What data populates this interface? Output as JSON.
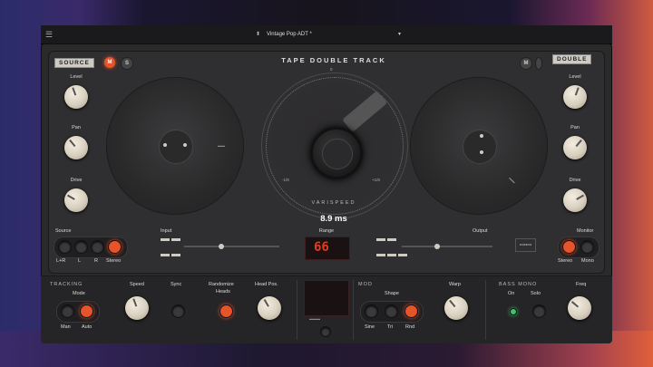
{
  "topbar": {
    "menu_icon": "menu-icon",
    "preset_name": "Vintage Pop ADT *",
    "preset_arrows": "⬍",
    "dropdown_icon": "▾"
  },
  "header": {
    "source_tag": "SOURCE",
    "double_tag": "DOUBLE",
    "title": "TAPE DOUBLE TRACK",
    "m_label": "M",
    "s_label": "S"
  },
  "left_knobs": [
    {
      "label": "Level"
    },
    {
      "label": "Pan"
    },
    {
      "label": "Drive"
    }
  ],
  "right_knobs": [
    {
      "label": "Level"
    },
    {
      "label": "Pan"
    },
    {
      "label": "Drive"
    }
  ],
  "varispeed": {
    "label": "VARISPEED",
    "value": "8.9 ms",
    "range_label": "Range",
    "scale_min": "-1/8",
    "scale_max": "+1/8",
    "scale_top": "0"
  },
  "source": {
    "label": "Source",
    "buttons": [
      "L+R",
      "L",
      "R",
      "Stereo"
    ]
  },
  "monitor": {
    "label": "Monitor",
    "buttons": [
      "Stereo",
      "Mono"
    ]
  },
  "input": {
    "label": "Input"
  },
  "output": {
    "label": "Output"
  },
  "range_display": {
    "value": "66"
  },
  "ldt_logo": "ꟷꟷ",
  "tracking": {
    "section": "TRACKING",
    "mode_label": "Mode",
    "buttons": [
      "Man",
      "Auto"
    ],
    "speed_label": "Speed",
    "sync_label": "Sync",
    "randomize_label": "Randomize",
    "heads_label": "Heads",
    "headpos_label": "Head Pos."
  },
  "mod": {
    "section": "MOD",
    "shape_label": "Shape",
    "buttons": [
      "Sine",
      "Tri",
      "Rnd"
    ],
    "warp_label": "Warp"
  },
  "bass_mono": {
    "section": "BASS MONO",
    "on_label": "On",
    "solo_label": "Solo",
    "freq_label": "Freq"
  }
}
